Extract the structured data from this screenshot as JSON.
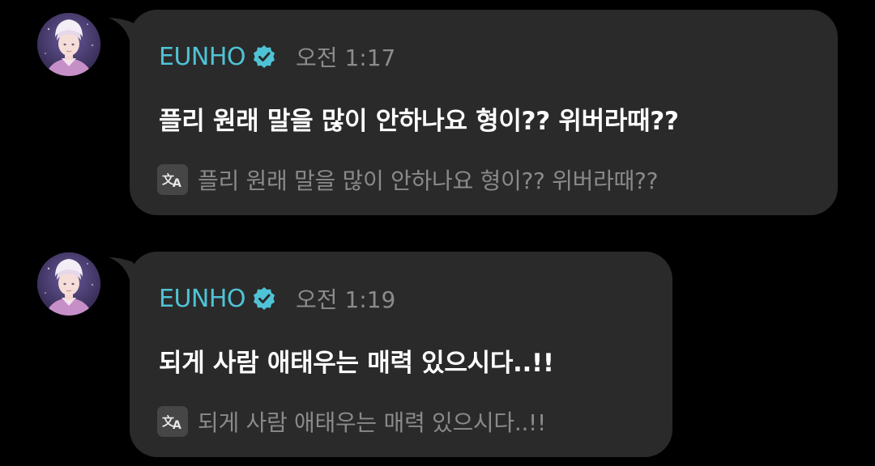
{
  "messages": [
    {
      "sender": "EUNHO",
      "time": "오전 1:17",
      "text": "플리 원래 말을 많이 안하나요 형이?? 위버라때??",
      "translation": "플리 원래 말을 많이 안하나요 형이?? 위버라때??"
    },
    {
      "sender": "EUNHO",
      "time": "오전 1:19",
      "text": "되게 사람 애태우는 매력 있으시다..!!",
      "translation": "되게 사람 애태우는 매력 있으시다..!!"
    }
  ],
  "colors": {
    "background": "#000000",
    "bubble": "#2a2a2a",
    "name": "#4fc3d6",
    "time": "#8c8c8c",
    "translation": "#8a8a8a"
  },
  "icons": {
    "verified": "verified-badge-icon",
    "translate": "translate-icon",
    "avatar": "avatar"
  }
}
